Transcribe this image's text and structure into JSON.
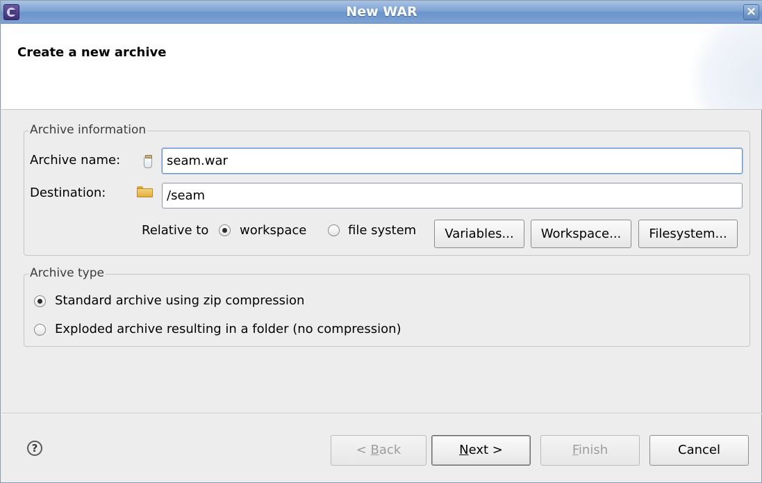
{
  "window": {
    "title": "New WAR",
    "close_glyph": "×"
  },
  "header": {
    "title": "Create a new archive"
  },
  "archive_information": {
    "legend": "Archive information",
    "name_label": "Archive name:",
    "name_value": "seam.war",
    "destination_label": "Destination:",
    "destination_value": "/seam",
    "relative_to_label": "Relative to",
    "relative_options": [
      {
        "label": "workspace",
        "checked": true
      },
      {
        "label": "file system",
        "checked": false
      }
    ],
    "buttons": {
      "variables": "Variables...",
      "workspace": "Workspace...",
      "filesystem": "Filesystem..."
    }
  },
  "archive_type": {
    "legend": "Archive type",
    "options": [
      {
        "label": "Standard archive using zip compression",
        "checked": true
      },
      {
        "label": "Exploded archive resulting in a folder (no compression)",
        "checked": false
      }
    ]
  },
  "footer": {
    "help_glyph": "?",
    "back_prefix": "< ",
    "back_mnemonic": "B",
    "back_rest": "ack",
    "next_mnemonic": "N",
    "next_rest": "ext >",
    "finish_mnemonic": "F",
    "finish_rest": "inish",
    "cancel": "Cancel"
  },
  "icons": {
    "title_app": "eclipse-icon",
    "archive_name": "jar-icon",
    "destination": "folder-open-icon",
    "help": "help-icon"
  }
}
